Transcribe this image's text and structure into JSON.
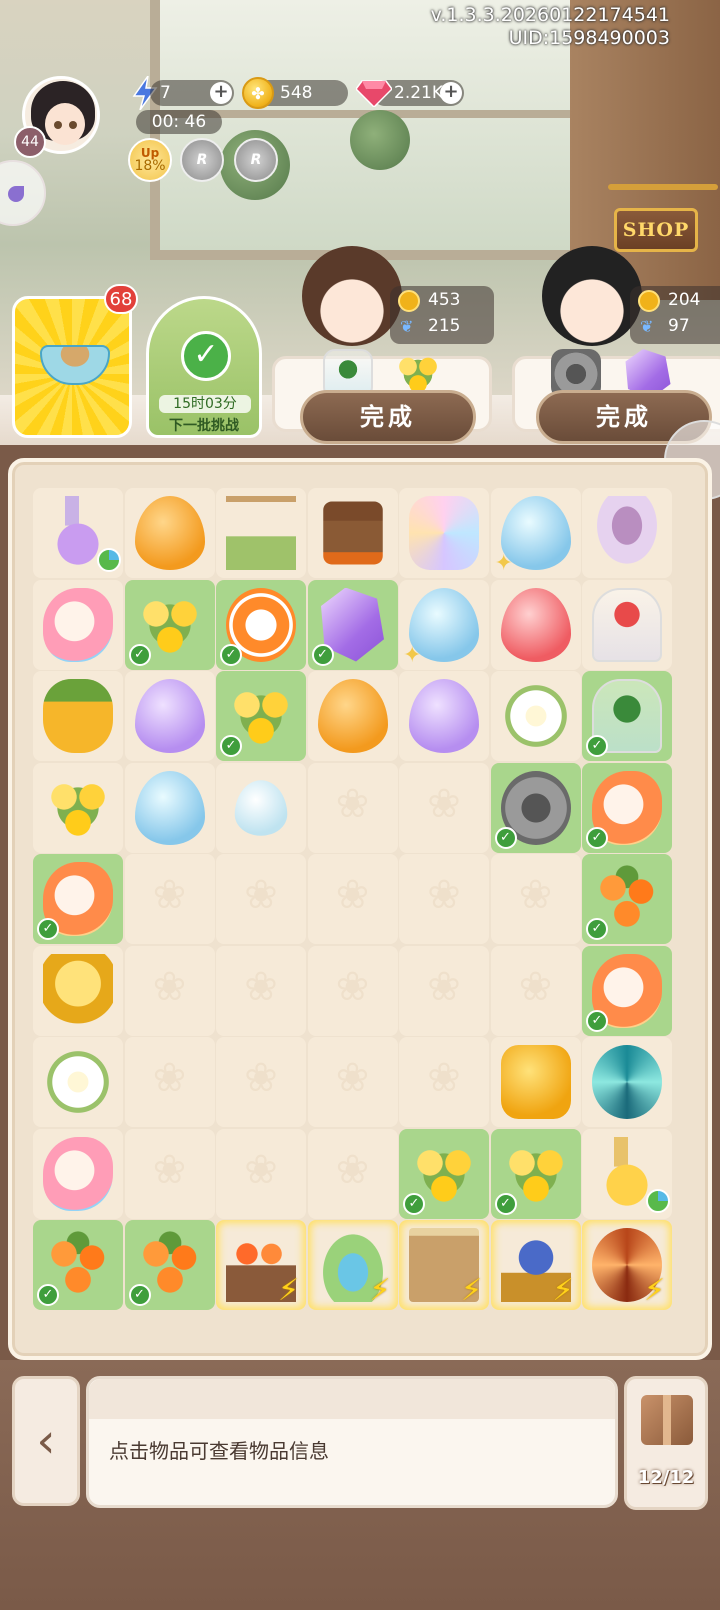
{
  "hud": {
    "version": "v.1.3.3.20260122174541",
    "uid": "UID:1598490003",
    "player_level": "44",
    "energy": "7",
    "energy_timer": "00: 46",
    "coins": "548",
    "gems": "2.21K",
    "buff_percent": "18%",
    "buff_label": "Up",
    "buff_r1": "R",
    "buff_r2": "R"
  },
  "shop": {
    "label": "SHOP"
  },
  "quests": {
    "tile1_count": "68",
    "tile2_time": "15时03分",
    "tile2_label": "下一批挑战"
  },
  "customers": [
    {
      "coins": "453",
      "butterflies": "215",
      "button": "完成"
    },
    {
      "coins": "204",
      "butterflies": "97",
      "button": "完成"
    }
  ],
  "board": {
    "rows": [
      [
        "bottle-purple",
        "drop-orange",
        "gazebo",
        "stump",
        "gem",
        "drop-blue",
        "cup"
      ],
      [
        "fish-pink",
        "flower-yellow",
        "clown",
        "crystal",
        "drop-blue",
        "drop-red",
        "mushroom-jar"
      ],
      [
        "pineapple",
        "drop-purple",
        "flower-yellow",
        "drop-orange",
        "drop-purple",
        "lily",
        "tree-jar"
      ],
      [
        "flower-yellow",
        "drop-blue",
        "drop-pale",
        "empty",
        "empty",
        "stone",
        "fish"
      ],
      [
        "fish",
        "empty",
        "empty",
        "empty",
        "empty",
        "empty",
        "flower-orange"
      ],
      [
        "coins",
        "empty",
        "empty",
        "empty",
        "empty",
        "empty",
        "fish"
      ],
      [
        "lily",
        "empty",
        "empty",
        "empty",
        "empty",
        "amber",
        "swirl"
      ],
      [
        "fish-pink",
        "empty",
        "empty",
        "empty",
        "flower-yellow",
        "flower-yellow",
        "bottle-yellow"
      ],
      [
        "flower-orange",
        "flower-orange",
        "flowerbed",
        "bridge",
        "shelf",
        "teapot",
        "swirl-orange"
      ]
    ]
  },
  "bottom": {
    "back_icon": "‹",
    "info_text": "点击物品可查看物品信息",
    "storage_count": "12/12"
  }
}
